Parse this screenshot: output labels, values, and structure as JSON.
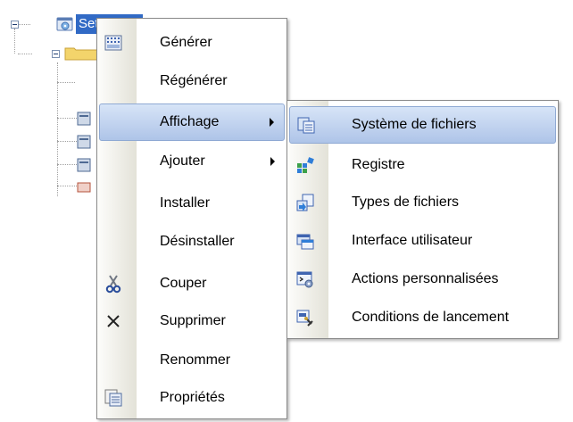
{
  "tree": {
    "root_label": "Setup2"
  },
  "context_menu": {
    "items": [
      {
        "label": "Générer",
        "icon": "build-icon"
      },
      {
        "label": "Régénérer",
        "icon": ""
      },
      {
        "label": "Affichage",
        "icon": "",
        "submenu": true,
        "highlighted": true
      },
      {
        "label": "Ajouter",
        "icon": "",
        "submenu": true
      },
      {
        "label": "Installer",
        "icon": ""
      },
      {
        "label": "Désinstaller",
        "icon": ""
      },
      {
        "label": "Couper",
        "icon": "scissors-icon"
      },
      {
        "label": "Supprimer",
        "icon": "delete-x-icon"
      },
      {
        "label": "Renommer",
        "icon": ""
      },
      {
        "label": "Propriétés",
        "icon": "properties-icon"
      }
    ]
  },
  "submenu": {
    "items": [
      {
        "label": "Système de fichiers",
        "icon": "file-system-editor-icon",
        "highlighted": true
      },
      {
        "label": "Registre",
        "icon": "registry-editor-icon"
      },
      {
        "label": "Types de fichiers",
        "icon": "file-types-editor-icon"
      },
      {
        "label": "Interface utilisateur",
        "icon": "user-interface-editor-icon"
      },
      {
        "label": "Actions personnalisées",
        "icon": "custom-actions-editor-icon"
      },
      {
        "label": "Conditions de lancement",
        "icon": "launch-conditions-editor-icon"
      }
    ]
  },
  "colors": {
    "selection": "#316ac5",
    "highlight_top": "#d7e4f7",
    "highlight_bottom": "#aec4e8"
  }
}
